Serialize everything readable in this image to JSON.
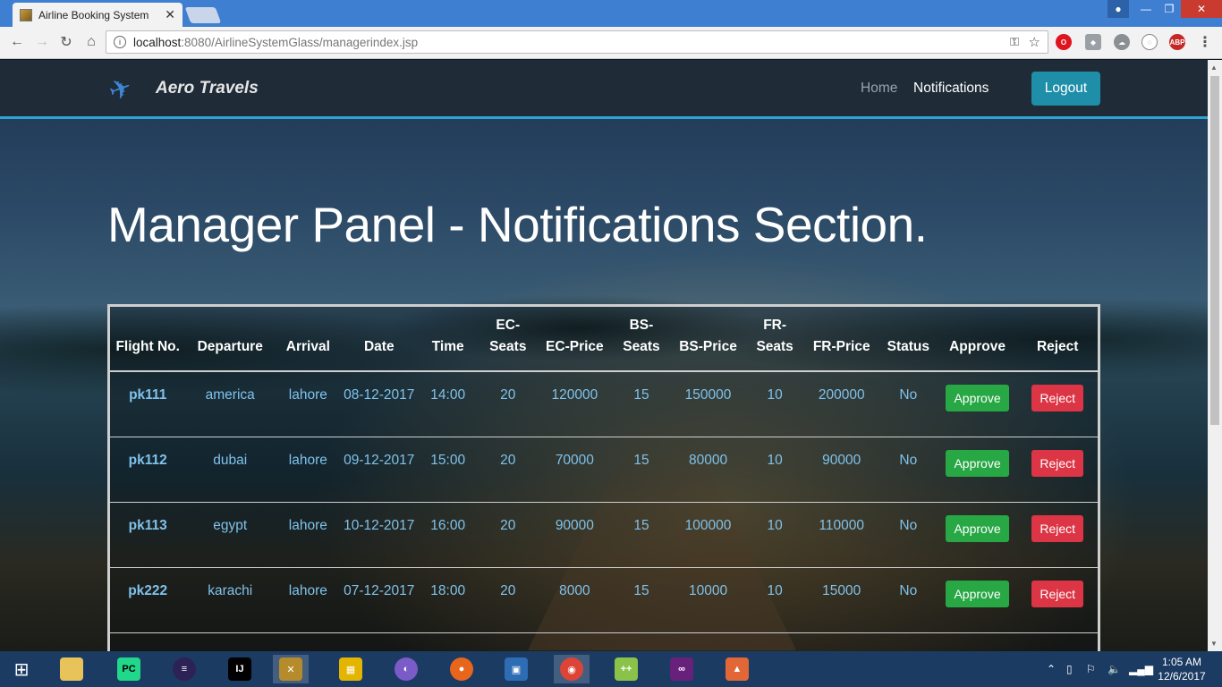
{
  "browser": {
    "tab_title": "Airline Booking System",
    "url_host": "localhost",
    "url_path": ":8080/AirlineSystemGlass/managerindex.jsp"
  },
  "navbar": {
    "brand": "Aero Travels",
    "home": "Home",
    "notifications": "Notifications",
    "logout": "Logout"
  },
  "heading": {
    "prefix": "Manager Panel - ",
    "strong": "Notifications Section",
    "suffix": "."
  },
  "table": {
    "headers": [
      "Flight No.",
      "Departure",
      "Arrival",
      "Date",
      "Time",
      "EC-Seats",
      "EC-Price",
      "BS-Seats",
      "BS-Price",
      "FR-Seats",
      "FR-Price",
      "Status",
      "Approve",
      "Reject"
    ],
    "approve_label": "Approve",
    "reject_label": "Reject",
    "rows": [
      [
        "pk111",
        "america",
        "lahore",
        "08-12-2017",
        "14:00",
        "20",
        "120000",
        "15",
        "150000",
        "10",
        "200000",
        "No"
      ],
      [
        "pk112",
        "dubai",
        "lahore",
        "09-12-2017",
        "15:00",
        "20",
        "70000",
        "15",
        "80000",
        "10",
        "90000",
        "No"
      ],
      [
        "pk113",
        "egypt",
        "lahore",
        "10-12-2017",
        "16:00",
        "20",
        "90000",
        "15",
        "100000",
        "10",
        "110000",
        "No"
      ],
      [
        "pk222",
        "karachi",
        "lahore",
        "07-12-2017",
        "18:00",
        "20",
        "8000",
        "15",
        "10000",
        "10",
        "15000",
        "No"
      ]
    ]
  },
  "taskbar": {
    "time": "1:05 AM",
    "date": "12/6/2017"
  },
  "colors": {
    "accent": "#2ea3d6",
    "logout": "#1f8ea9",
    "approve": "#28a745",
    "reject": "#dc3545",
    "cell_text": "#7fc2ea"
  }
}
